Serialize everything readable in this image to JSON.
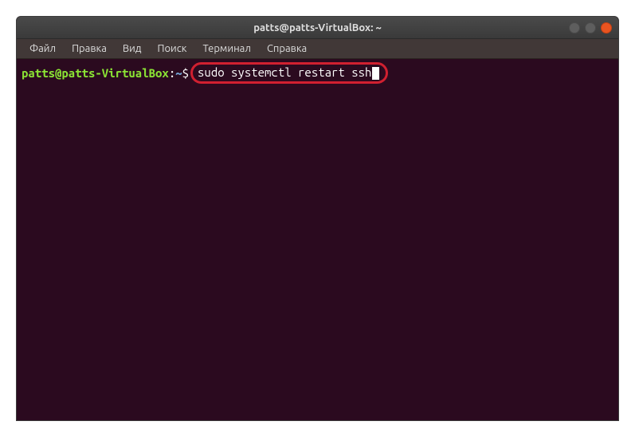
{
  "window": {
    "title": "patts@patts-VirtualBox: ~"
  },
  "menubar": {
    "items": [
      {
        "label": "Файл"
      },
      {
        "label": "Правка"
      },
      {
        "label": "Вид"
      },
      {
        "label": "Поиск"
      },
      {
        "label": "Терминал"
      },
      {
        "label": "Справка"
      }
    ]
  },
  "terminal": {
    "prompt_user": "patts@patts-VirtualBox",
    "prompt_colon": ":",
    "prompt_path": "~",
    "prompt_dollar": "$",
    "command": "sudo systemctl restart ssh"
  }
}
